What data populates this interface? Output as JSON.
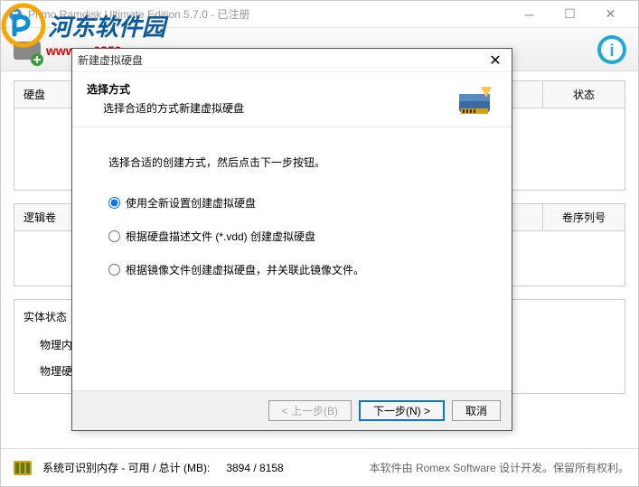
{
  "window": {
    "title": "Primo Ramdisk Ultimate Edition 5.7.0 - 已注册"
  },
  "watermark": {
    "brand": "河东软件园",
    "url": "www.pc0359.cn"
  },
  "panels": {
    "disk": {
      "label_disk": "硬盘",
      "label_status": "状态"
    },
    "volume": {
      "label_volume": "逻辑卷",
      "label_serial": "卷序列号"
    },
    "entity": {
      "label_entity": "实体状态",
      "row1": "物理内",
      "row2": "物理硬"
    }
  },
  "statusbar": {
    "mem_label": "系统可识别内存 - 可用 / 总计 (MB):",
    "mem_value": "3894 / 8158",
    "copyright": "本软件由 Romex Software 设计开发。保留所有权利。"
  },
  "dialog": {
    "title": "新建虚拟硬盘",
    "header_title": "选择方式",
    "header_sub": "选择合适的方式新建虚拟硬盘",
    "instruction": "选择合适的创建方式，然后点击下一步按钮。",
    "option1": "使用全新设置创建虚拟硬盘",
    "option2": "根据硬盘描述文件 (*.vdd) 创建虚拟硬盘",
    "option3": "根据镜像文件创建虚拟硬盘，并关联此镜像文件。",
    "btn_back": "< 上一步(B)",
    "btn_next": "下一步(N) >",
    "btn_cancel": "取消"
  }
}
